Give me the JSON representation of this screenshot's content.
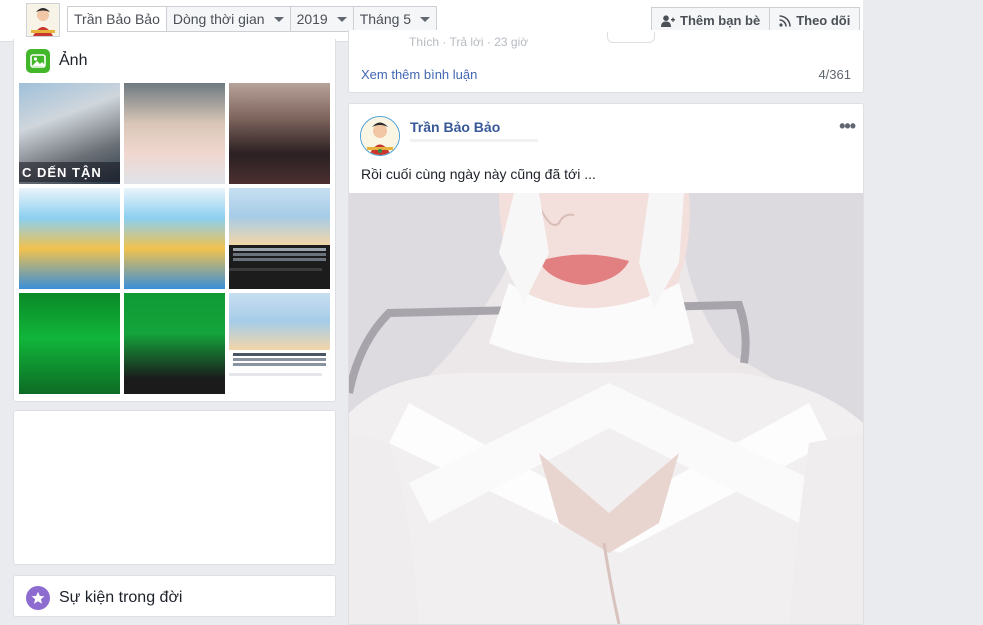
{
  "topbar": {
    "profile_avatar": "profile-avatar",
    "breadcrumbs": [
      {
        "label": "Trần Bảo Bảo",
        "has_caret": false
      },
      {
        "label": "Dòng thời gian",
        "has_caret": true
      },
      {
        "label": "2019",
        "has_caret": true
      },
      {
        "label": "Tháng 5",
        "has_caret": true
      }
    ],
    "add_friend_label": "Thêm bạn bè",
    "follow_label": "Theo dõi"
  },
  "sidebar": {
    "photos_title": "Ảnh",
    "photo_overlay_text": "C DẾN TẬN",
    "photos": [
      {
        "name": "photo-1"
      },
      {
        "name": "photo-2"
      },
      {
        "name": "photo-3"
      },
      {
        "name": "photo-4"
      },
      {
        "name": "photo-5"
      },
      {
        "name": "photo-6"
      },
      {
        "name": "photo-7"
      },
      {
        "name": "photo-8"
      },
      {
        "name": "photo-9"
      }
    ],
    "life_events_title": "Sự kiện trong đời"
  },
  "comments": {
    "faded_actions": "Thích · Trả lời · 23 giờ",
    "see_more_label": "Xem thêm bình luận",
    "count": "4/361"
  },
  "post": {
    "author": "Trần Bảo Bảo",
    "text": "Rồi cuối cùng ngày này cũng đã tới ...",
    "more_icon": "•••"
  },
  "colors": {
    "link_blue": "#385898",
    "photos_icon_green": "#42b72a",
    "life_icon_purple": "#8d6ccf",
    "page_bg": "#e9ebee"
  }
}
